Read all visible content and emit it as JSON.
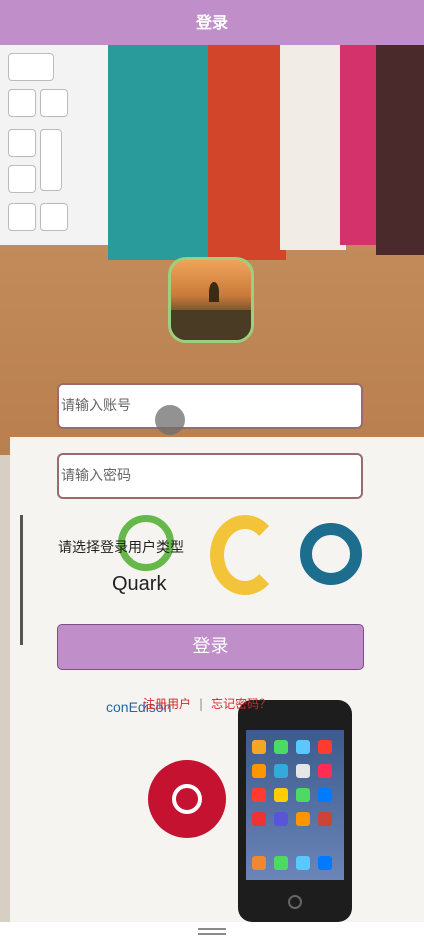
{
  "header": {
    "title": "登录"
  },
  "form": {
    "account_placeholder": "请输入账号",
    "password_placeholder": "请输入密码",
    "user_type_prompt": "请选择登录用户类型",
    "login_button": "登录"
  },
  "links": {
    "register": "注册用户",
    "separator": "|",
    "forgot": "忘记密码？"
  },
  "background_logos": {
    "quark": "Quark",
    "conedison": "conEdison"
  },
  "colors": {
    "header": "#c08fca",
    "button": "#c08fca",
    "link": "#d12a2a",
    "input_border": "#9b6b6b"
  },
  "icons": {
    "avatar": "landscape-avatar-icon",
    "handle": "drag-handle-icon"
  }
}
